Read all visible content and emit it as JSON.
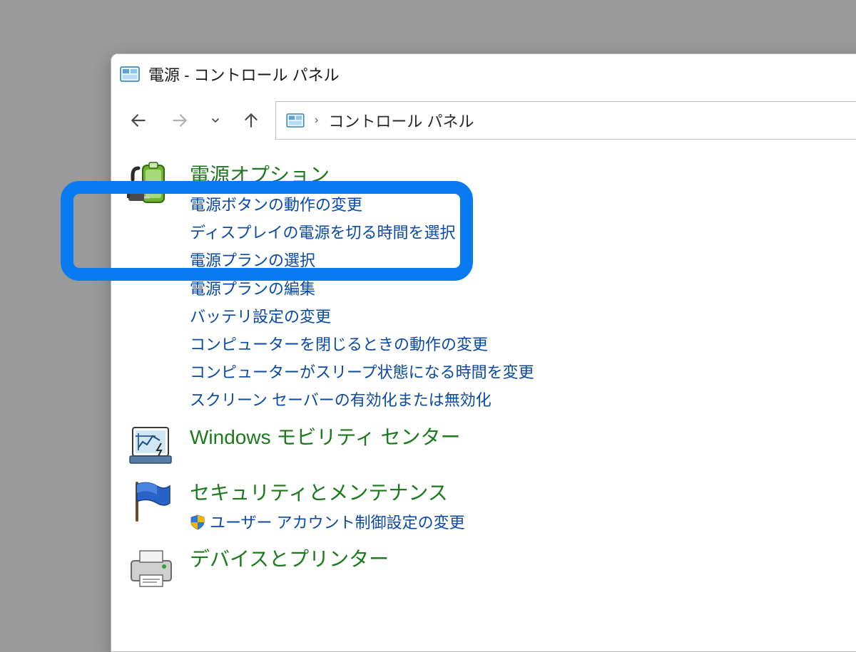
{
  "titlebar": {
    "title": "電源 - コントロール パネル"
  },
  "breadcrumb": {
    "root": "コントロール パネル"
  },
  "categories": [
    {
      "id": "power",
      "title": "電源オプション",
      "links": [
        "電源ボタンの動作の変更",
        "ディスプレイの電源を切る時間を選択",
        "電源プランの選択",
        "電源プランの編集",
        "バッテリ設定の変更",
        "コンピューターを閉じるときの動作の変更",
        "コンピューターがスリープ状態になる時間を変更",
        "スクリーン セーバーの有効化または無効化"
      ]
    },
    {
      "id": "mobility",
      "title": "Windows モビリティ センター",
      "links": []
    },
    {
      "id": "security",
      "title": "セキュリティとメンテナンス",
      "links": [
        {
          "shield": true,
          "text": "ユーザー アカウント制御設定の変更"
        }
      ]
    },
    {
      "id": "devices",
      "title": "デバイスとプリンター",
      "links": []
    }
  ]
}
